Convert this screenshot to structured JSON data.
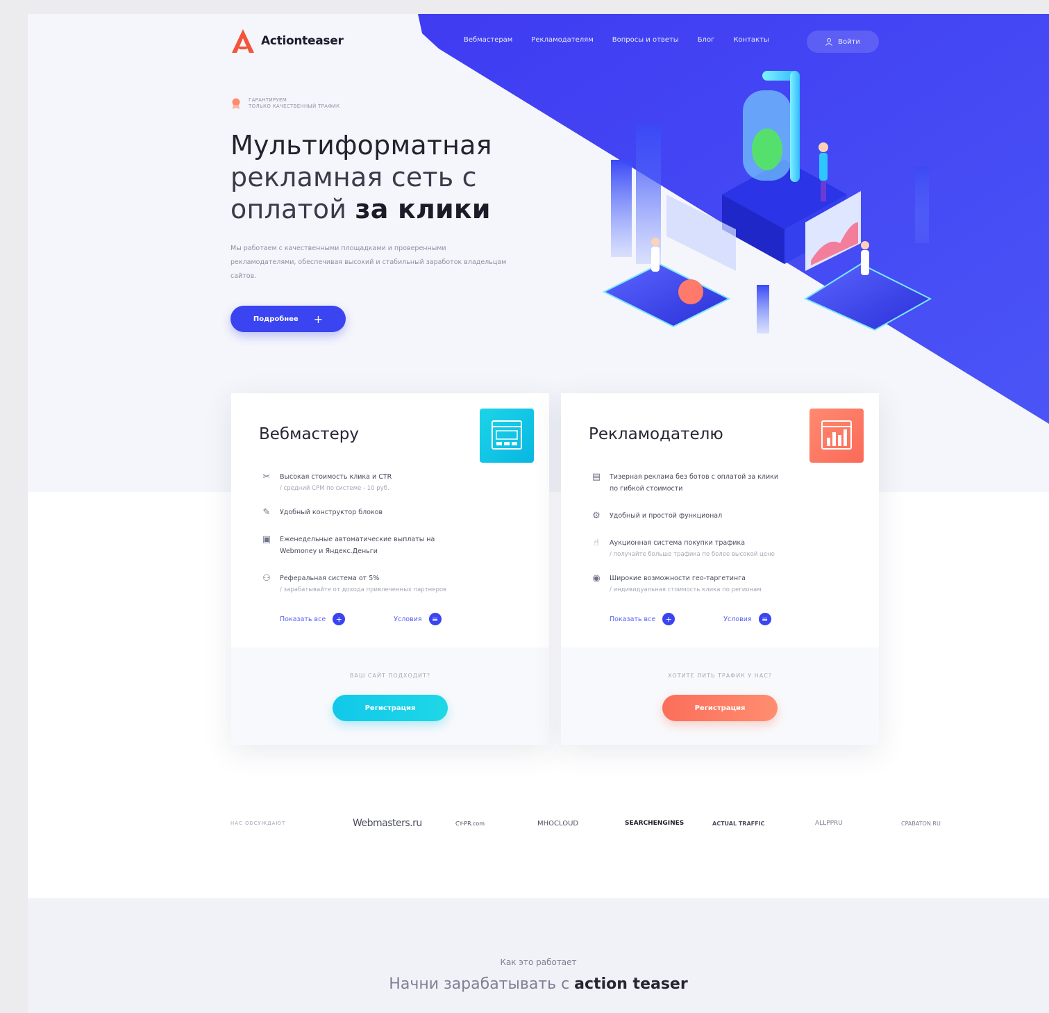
{
  "brand": {
    "name": "Actionteaser",
    "color": "#3a44f0",
    "accent": "#f2553a"
  },
  "nav": {
    "items": [
      "Вебмастерам",
      "Рекламодателям",
      "Вопросы и ответы",
      "Блог",
      "Контакты"
    ],
    "login": "Войти"
  },
  "hero": {
    "badge_line1": "ГАРАНТИРУЕМ",
    "badge_line2": "ТОЛЬКО КАЧЕСТВЕННЫЙ ТРАФИК",
    "title_line1": "Мультиформатная",
    "title_line2": "рекламная сеть с",
    "title_line3_normal": "оплатой ",
    "title_line3_bold": "за клики",
    "description": "Мы работаем с качественными площадками и проверенными рекламодателями, обеспечивая высокий и стабильный заработок владельцам сайтов.",
    "more_label": "Подробнее",
    "more_icon": "plus-icon"
  },
  "cards": [
    {
      "title": "Вебмастеру",
      "icon": "browser-window-icon",
      "features": [
        {
          "icon": "cursor-icon",
          "main": "Высокая стоимость клика и CTR",
          "sub": "/ средний CPM по системе - 10 руб."
        },
        {
          "icon": "pencil-icon",
          "main": "Удобный конструктор блоков",
          "sub": ""
        },
        {
          "icon": "wallet-icon",
          "main": "Еженедельные автоматические выплаты на Webmoney и Яндекс.Деньги",
          "sub": ""
        },
        {
          "icon": "network-icon",
          "main": "Реферальная система от 5%",
          "sub": "/ зарабатывайте от дохода привлеченных партнеров"
        }
      ],
      "link_all": "Показать все",
      "link_terms": "Условия",
      "footer_question": "ВАШ САЙТ ПОДХОДИТ?",
      "register": "Регистрация",
      "color": "#12c8ea"
    },
    {
      "title": "Рекламодателю",
      "icon": "bar-chart-icon",
      "features": [
        {
          "icon": "monitor-icon",
          "main": "Тизерная реклама без ботов с оплатой за клики по гибкой стоимости",
          "sub": ""
        },
        {
          "icon": "gear-icon",
          "main": "Удобный и простой функционал",
          "sub": ""
        },
        {
          "icon": "hand-icon",
          "main": "Аукционная система покупки трафика",
          "sub": "/ получайте больше трафика по более высокой цене"
        },
        {
          "icon": "globe-icon",
          "main": "Широкие возможности гео-таргетинга",
          "sub": "/ индивидуальная стоимость клика по регионам"
        }
      ],
      "link_all": "Показать все",
      "link_terms": "Условия",
      "footer_question": "ХОТИТЕ ЛИТЬ ТРАФИК У НАС?",
      "register": "Регистрация",
      "color": "#fb6f5a"
    }
  ],
  "partners": {
    "label": "НАС ОБСУЖДАЮТ",
    "items": [
      "Webmasters.ru",
      "CY-PR.com",
      "MHOCLOUD",
      "SEARCHENGINES",
      "ACTUAL TRAFFIC",
      "ALLPPRU",
      "CPABATON.RU"
    ]
  },
  "how": {
    "small": "Как это работает",
    "big_normal": "Начни зарабатывать с ",
    "big_bold": "action teaser"
  }
}
